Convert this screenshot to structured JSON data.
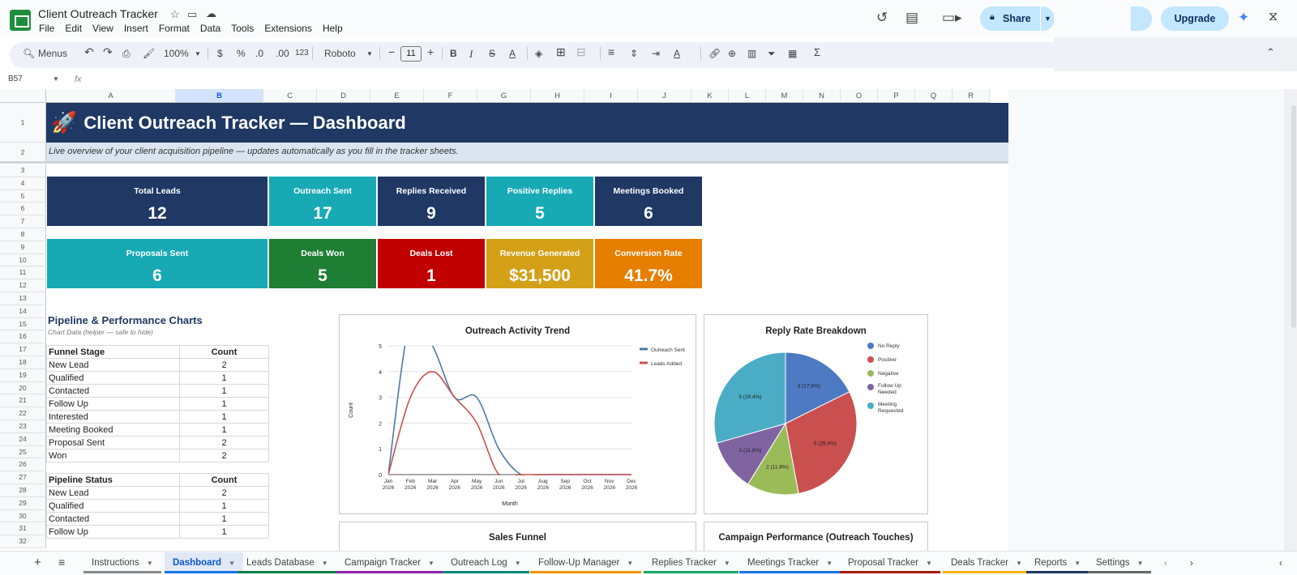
{
  "doc": {
    "title": "Client Outreach Tracker"
  },
  "menus": [
    "File",
    "Edit",
    "View",
    "Insert",
    "Format",
    "Data",
    "Tools",
    "Extensions",
    "Help"
  ],
  "share": {
    "label": "Share"
  },
  "upgrade": {
    "label": "Upgrade"
  },
  "toolbar": {
    "menus": "Menus",
    "zoom": "100%",
    "currency": "$",
    "percent": "%",
    "dec_less": ".0",
    "dec_more": ".00",
    "num123": "123",
    "font": "Roboto",
    "font_size": "11"
  },
  "formula": {
    "cell": "B57",
    "fx": "fx"
  },
  "columns": [
    "A",
    "B",
    "C",
    "D",
    "E",
    "F",
    "G",
    "H",
    "I",
    "J",
    "K",
    "L",
    "M",
    "N",
    "O",
    "P",
    "Q",
    "R"
  ],
  "rows": [
    "1",
    "2",
    "3",
    "4",
    "5",
    "6",
    "7",
    "8",
    "9",
    "10",
    "11",
    "12",
    "13",
    "14",
    "15",
    "16",
    "17",
    "18",
    "19",
    "20",
    "21",
    "22",
    "23",
    "24",
    "25",
    "26",
    "27",
    "28",
    "29",
    "30",
    "31",
    "32"
  ],
  "header": {
    "title": "Client Outreach Tracker — Dashboard",
    "subtitle": "Live overview of your client acquisition pipeline — updates automatically as you fill in the tracker sheets."
  },
  "kpis_row1": [
    {
      "label": "Total Leads",
      "value": "12",
      "color": "#1f3864"
    },
    {
      "label": "Outreach Sent",
      "value": "17",
      "color": "#17aab5"
    },
    {
      "label": "Replies Received",
      "value": "9",
      "color": "#1f3864"
    },
    {
      "label": "Positive Replies",
      "value": "5",
      "color": "#17aab5"
    },
    {
      "label": "Meetings Booked",
      "value": "6",
      "color": "#1f3864"
    }
  ],
  "kpis_row2": [
    {
      "label": "Proposals Sent",
      "value": "6",
      "color": "#17aab5"
    },
    {
      "label": "Deals Won",
      "value": "5",
      "color": "#1e7e34"
    },
    {
      "label": "Deals Lost",
      "value": "1",
      "color": "#c00000"
    },
    {
      "label": "Revenue Generated",
      "value": "$31,500",
      "color": "#d4a017"
    },
    {
      "label": "Conversion Rate",
      "value": "41.7%",
      "color": "#e67e00"
    }
  ],
  "section": {
    "title": "Pipeline & Performance Charts",
    "subtitle": "Chart Data (helper — safe to hide)"
  },
  "funnel_table": {
    "h1": "Funnel Stage",
    "h2": "Count",
    "rows": [
      [
        "New Lead",
        "2"
      ],
      [
        "Qualified",
        "1"
      ],
      [
        "Contacted",
        "1"
      ],
      [
        "Follow Up",
        "1"
      ],
      [
        "Interested",
        "1"
      ],
      [
        "Meeting Booked",
        "1"
      ],
      [
        "Proposal Sent",
        "2"
      ],
      [
        "Won",
        "2"
      ]
    ]
  },
  "status_table": {
    "h1": "Pipeline Status",
    "h2": "Count",
    "rows": [
      [
        "New Lead",
        "2"
      ],
      [
        "Qualified",
        "1"
      ],
      [
        "Contacted",
        "1"
      ],
      [
        "Follow Up",
        "1"
      ]
    ]
  },
  "chart_titles": {
    "trend": "Outreach Activity Trend",
    "reply": "Reply Rate Breakdown",
    "funnel": "Sales Funnel",
    "campaign": "Campaign Performance (Outreach Touches)"
  },
  "chart_data": [
    {
      "type": "line",
      "title": "Outreach Activity Trend",
      "xlabel": "Month",
      "ylabel": "Count",
      "ylim": [
        0,
        5
      ],
      "x": [
        "Jan\n2026",
        "Feb\n2026",
        "Mar\n2026",
        "Apr\n2026",
        "May\n2026",
        "Jun\n2026",
        "Jul\n2026",
        "Aug\n2026",
        "Sep\n2026",
        "Oct\n2026",
        "Nov\n2026",
        "Dec\n2026"
      ],
      "series": [
        {
          "name": "Outreach Sent",
          "color": "#4e79a7",
          "values": [
            0,
            6,
            5,
            3,
            3,
            1,
            0,
            0,
            0,
            0,
            0,
            0
          ]
        },
        {
          "name": "Leads Added",
          "color": "#c9504f",
          "values": [
            0,
            3,
            4,
            3,
            2,
            0,
            0,
            0,
            0,
            0,
            0,
            0
          ]
        }
      ],
      "legend": "top-right",
      "grid": true
    },
    {
      "type": "pie",
      "title": "Reply Rate Breakdown",
      "legend": "right",
      "slices": [
        {
          "name": "No Reply",
          "value": 3,
          "label": "3 (17.6%)",
          "color": "#4e79c3"
        },
        {
          "name": "Positive",
          "value": 5,
          "label": "5 (29.4%)",
          "color": "#c9504f"
        },
        {
          "name": "Negative",
          "value": 2,
          "label": "2 (11.8%)",
          "color": "#9bbb59"
        },
        {
          "name": "Follow Up Needed",
          "value": 2,
          "label": "2 (11.8%)",
          "color": "#8064a2"
        },
        {
          "name": "Meeting Requested",
          "value": 5,
          "label": "5 (29.4%)",
          "color": "#4bacc6"
        }
      ]
    }
  ],
  "tabs": [
    {
      "label": "Instructions",
      "color": "#888"
    },
    {
      "label": "Dashboard",
      "color": "#1a73e8"
    },
    {
      "label": "Leads Database",
      "color": "#0b8043"
    },
    {
      "label": "Campaign Tracker",
      "color": "#8e24aa"
    },
    {
      "label": "Outreach Log",
      "color": "#00897b"
    },
    {
      "label": "Follow-Up Manager",
      "color": "#f09300"
    },
    {
      "label": "Replies Tracker",
      "color": "#16a766"
    },
    {
      "label": "Meetings Tracker",
      "color": "#1a73e8"
    },
    {
      "label": "Proposal Tracker",
      "color": "#a61c00"
    },
    {
      "label": "Deals Tracker",
      "color": "#f4b400"
    },
    {
      "label": "Reports",
      "color": "#1f3864"
    },
    {
      "label": "Settings",
      "color": "#666"
    }
  ]
}
